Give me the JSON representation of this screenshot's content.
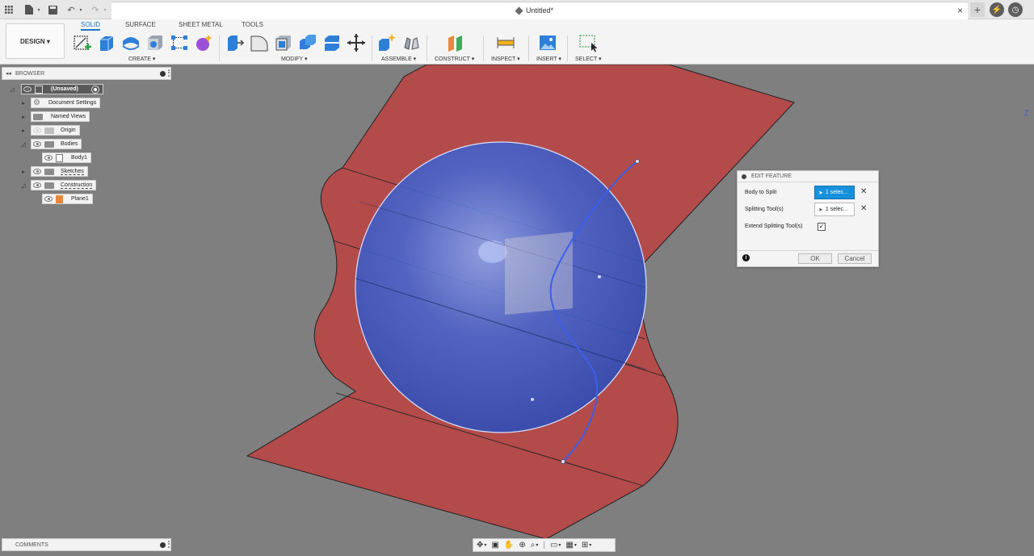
{
  "window": {
    "doc_title": "Untitled*"
  },
  "workspace": {
    "mode_label": "DESIGN ▾"
  },
  "tabs": [
    {
      "label": "SOLID",
      "active": true
    },
    {
      "label": "SURFACE",
      "active": false
    },
    {
      "label": "SHEET METAL",
      "active": false
    },
    {
      "label": "TOOLS",
      "active": false
    }
  ],
  "toolbar_groups": {
    "create": "CREATE ▾",
    "modify": "MODIFY ▾",
    "assemble": "ASSEMBLE ▾",
    "construct": "CONSTRUCT ▾",
    "inspect": "INSPECT ▾",
    "insert": "INSERT ▾",
    "select": "SELECT ▾"
  },
  "browser": {
    "title": "BROWSER",
    "items": [
      {
        "label": "(Unsaved)"
      },
      {
        "label": "Document Settings"
      },
      {
        "label": "Named Views"
      },
      {
        "label": "Origin"
      },
      {
        "label": "Bodies"
      },
      {
        "label": "Body1"
      },
      {
        "label": "Sketches"
      },
      {
        "label": "Construction"
      },
      {
        "label": "Plane1"
      }
    ]
  },
  "comments": {
    "title": "COMMENTS"
  },
  "dialog": {
    "title": "EDIT FEATURE",
    "body_to_split_label": "Body to Split",
    "body_to_split_value": "1 selec...",
    "splitting_tools_label": "Splitting Tool(s)",
    "splitting_tools_value": "1 selec...",
    "extend_label": "Extend Splitting Tool(s)",
    "extend_checked": "✓",
    "ok_label": "OK",
    "cancel_label": "Cancel"
  },
  "viewport": {
    "axis_label": "Z"
  },
  "colors": {
    "accent": "#1e78c8",
    "surface_red": "#b34b4b",
    "sphere_blue": "#3f5fc9",
    "viewport_bg": "#7f7f7f"
  }
}
